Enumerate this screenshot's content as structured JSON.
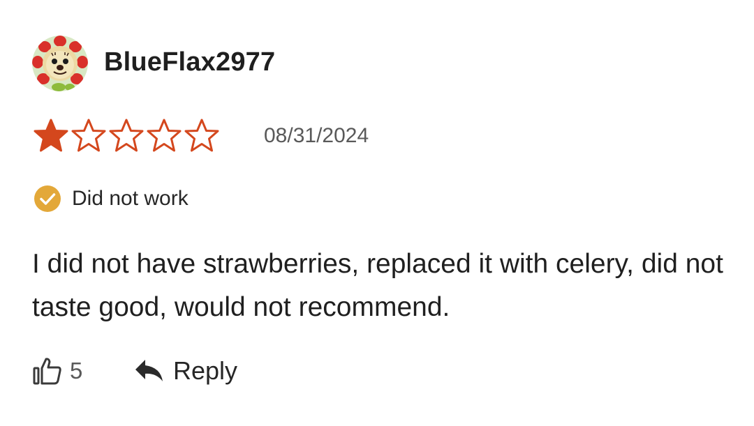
{
  "review": {
    "username": "BlueFlax2977",
    "rating": {
      "value": 1,
      "max": 5
    },
    "date": "08/31/2024",
    "tag": {
      "label": "Did not work",
      "icon": "check-circle-icon"
    },
    "text": "I did not have strawberries, replaced it with celery, did not taste good, would not recommend.",
    "actions": {
      "like_count": "5",
      "reply_label": "Reply"
    }
  },
  "colors": {
    "star": "#d4471d",
    "tag_icon": "#e3a839",
    "text": "#262626",
    "muted": "#595959"
  }
}
